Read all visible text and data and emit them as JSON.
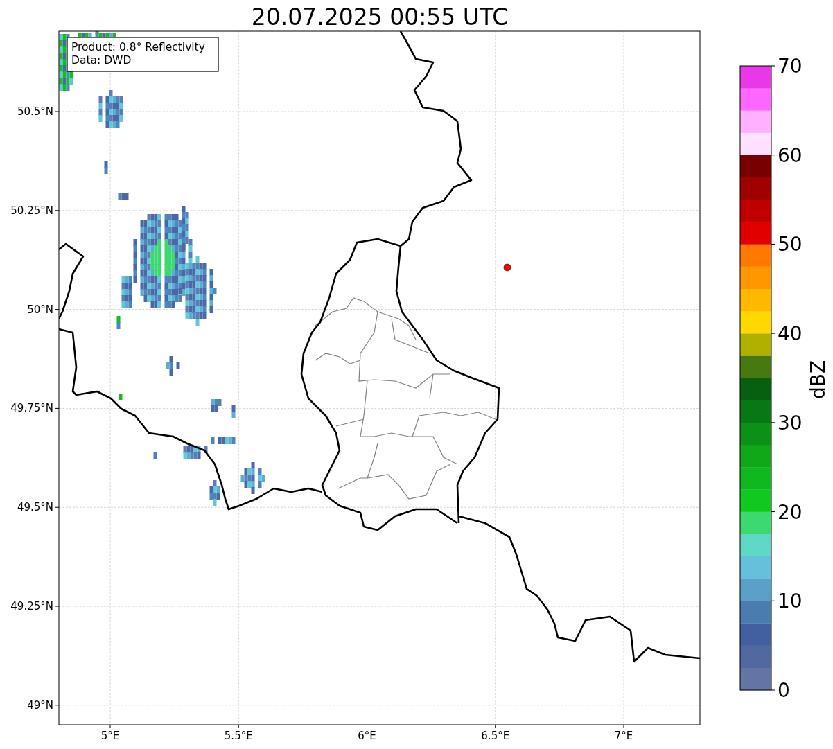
{
  "title": "20.07.2025 00:55 UTC",
  "info_box": [
    "Product: 0.8° Reflectivity",
    "Data: DWD"
  ],
  "map": {
    "x_ticks": [
      "5°E",
      "5.5°E",
      "6°E",
      "6.5°E",
      "7°E"
    ],
    "y_ticks": [
      "50.5°N",
      "50.25°N",
      "50°N",
      "49.75°N",
      "49.5°N",
      "49.25°N",
      "49°N"
    ]
  },
  "colorbar": {
    "label": "dBZ",
    "ticks": [
      "70",
      "60",
      "50",
      "40",
      "30",
      "20",
      "10",
      "0"
    ],
    "bins": [
      {
        "color": "#6474a4"
      },
      {
        "color": "#5268a0"
      },
      {
        "color": "#4260a0"
      },
      {
        "color": "#4a7cb0"
      },
      {
        "color": "#5aa0c8"
      },
      {
        "color": "#66c0dc"
      },
      {
        "color": "#60d8c8"
      },
      {
        "color": "#3cd870"
      },
      {
        "color": "#10c820"
      },
      {
        "color": "#10b820"
      },
      {
        "color": "#10a818"
      },
      {
        "color": "#0c9018"
      },
      {
        "color": "#087814"
      },
      {
        "color": "#066010"
      },
      {
        "color": "#487810"
      },
      {
        "color": "#b0b000"
      },
      {
        "color": "#ffd800"
      },
      {
        "color": "#ffb800"
      },
      {
        "color": "#ff9800"
      },
      {
        "color": "#ff7800"
      },
      {
        "color": "#e00000"
      },
      {
        "color": "#c00000"
      },
      {
        "color": "#a00000"
      },
      {
        "color": "#780000"
      },
      {
        "color": "#ffe0ff"
      },
      {
        "color": "#ffb0ff"
      },
      {
        "color": "#ff68ff"
      },
      {
        "color": "#e838e8"
      }
    ]
  }
}
